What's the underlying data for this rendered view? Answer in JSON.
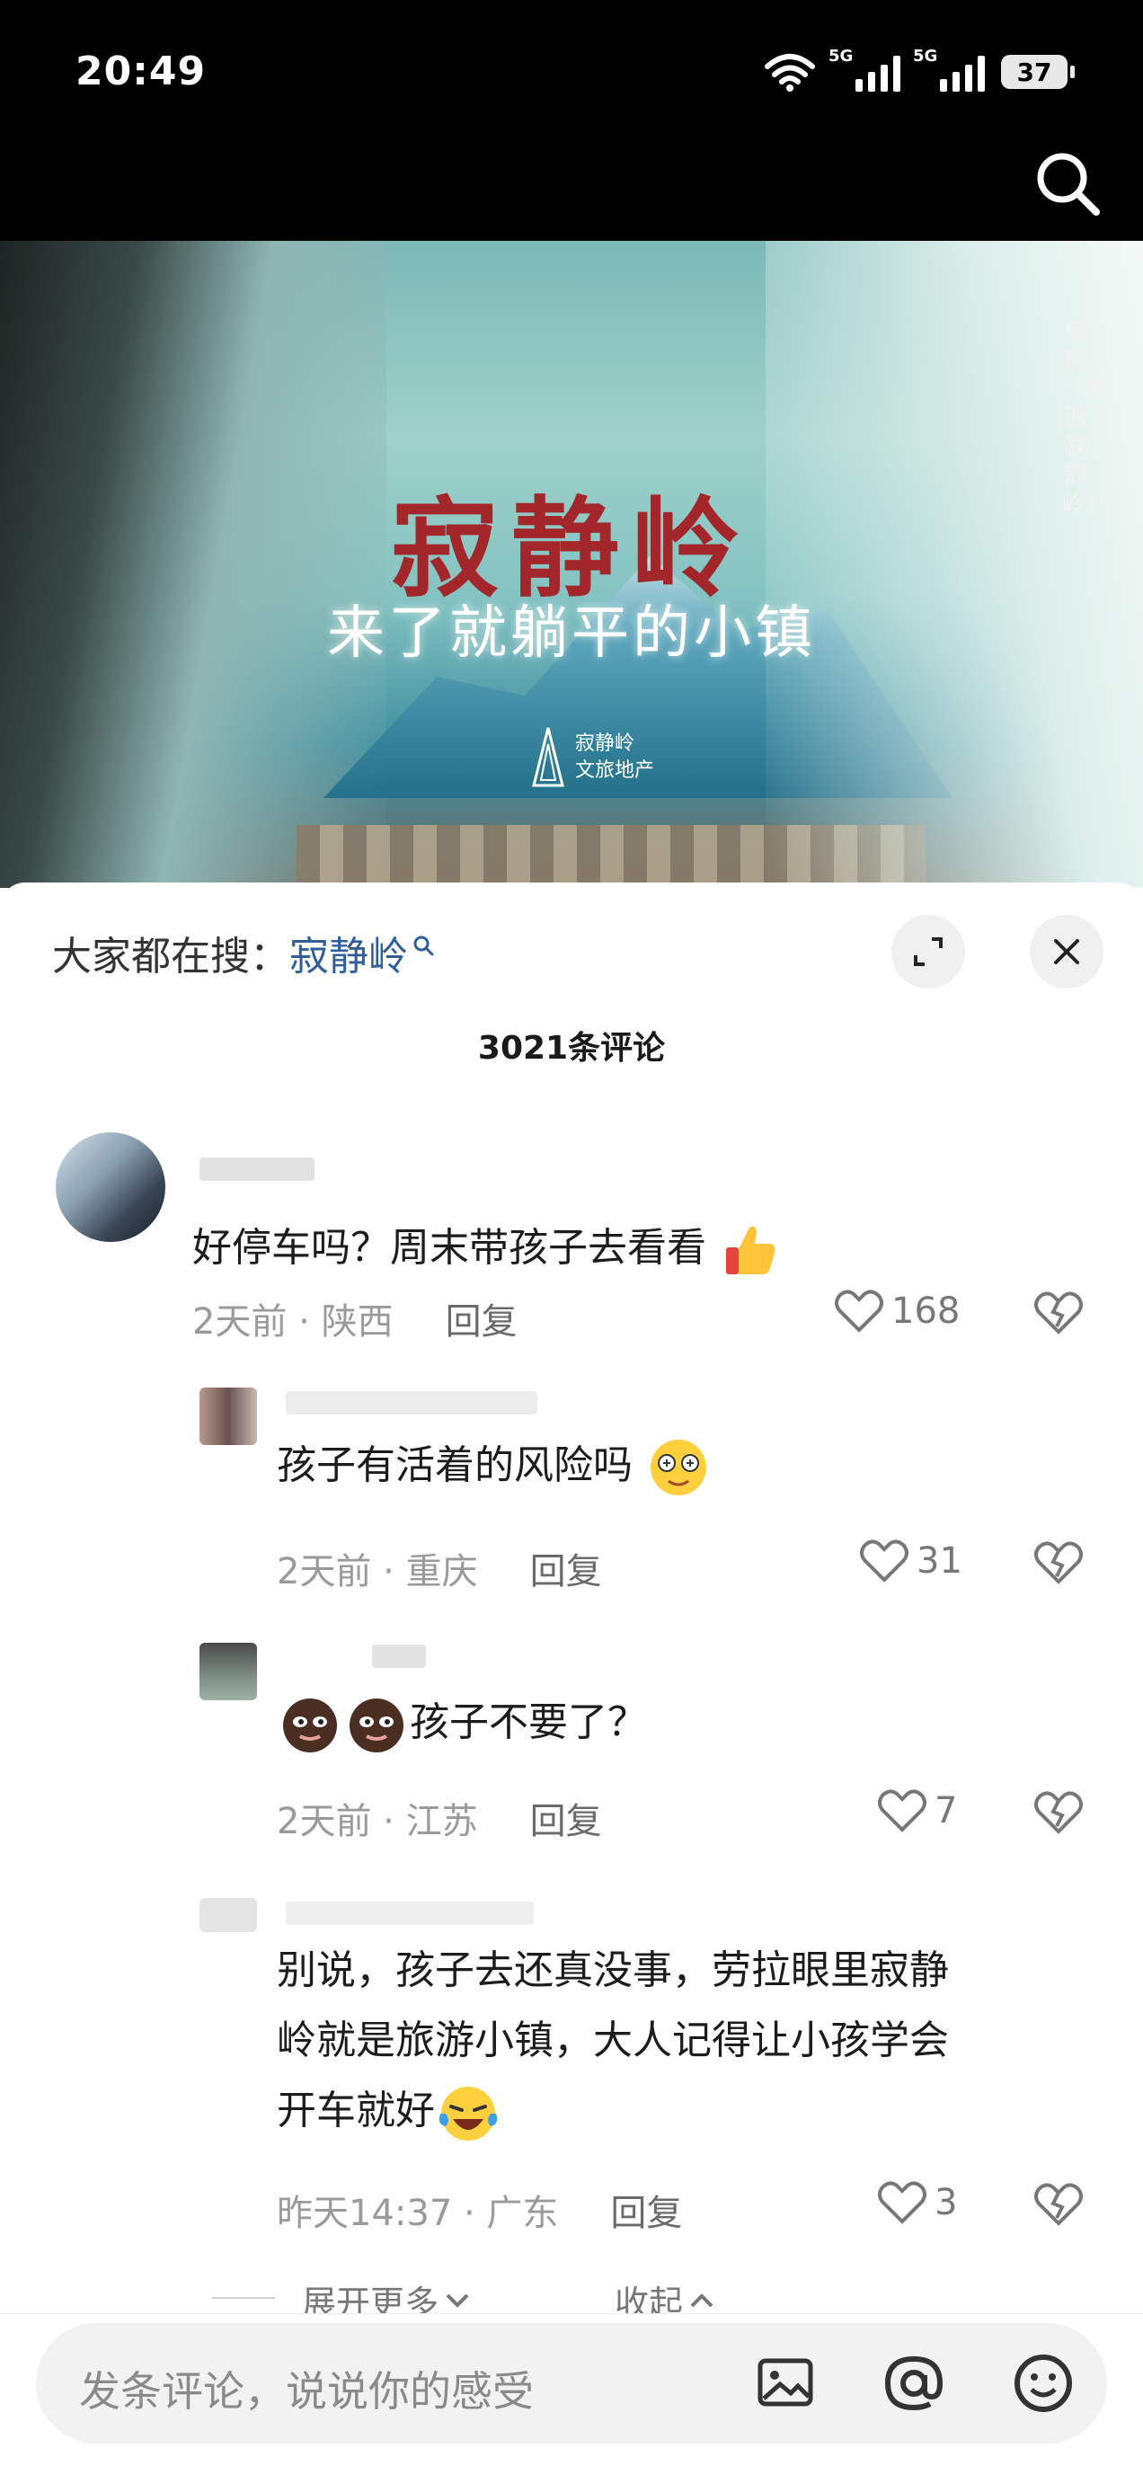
{
  "status_bar": {
    "time": "20:49",
    "signal1_label": "5G",
    "signal2_label": "5G",
    "battery": "37"
  },
  "video": {
    "title": "寂静岭",
    "subtitle": "来了就躺平的小镇",
    "logo_text_line1": "寂静岭",
    "logo_text_line2": "文旅地产",
    "side_caption": "电影《重返寂静岭》"
  },
  "sheet": {
    "search_prefix": "大家都在搜：",
    "search_keyword": "寂静岭",
    "comment_count": "3021条评论",
    "reply_label": "回复"
  },
  "comments": [
    {
      "text": "好停车吗？周末带孩子去看看",
      "time_location": "2天前 · 陕西",
      "likes": "168",
      "emoji": "thumbs-up"
    },
    {
      "text": "孩子有活着的风险吗",
      "time_location": "2天前 · 重庆",
      "likes": "31",
      "emoji": "dizzy-face"
    },
    {
      "text": "孩子不要了？",
      "time_location": "2天前 · 江苏",
      "likes": "7",
      "emoji": "brown-face"
    },
    {
      "text_line1": "别说，孩子去还真没事，劳拉眼里寂静",
      "text_line2": "岭就是旅游小镇，大人记得让小孩学会",
      "text_line3": "开车就好",
      "time_location": "昨天14:37 · 广东",
      "likes": "3",
      "emoji": "laughing-tears"
    }
  ],
  "expand": {
    "more": "展开更多",
    "collapse": "收起"
  },
  "input": {
    "placeholder": "发条评论，说说你的感受"
  },
  "colors": {
    "keyword_blue": "#2f5f9a",
    "title_red": "#a3262b"
  }
}
